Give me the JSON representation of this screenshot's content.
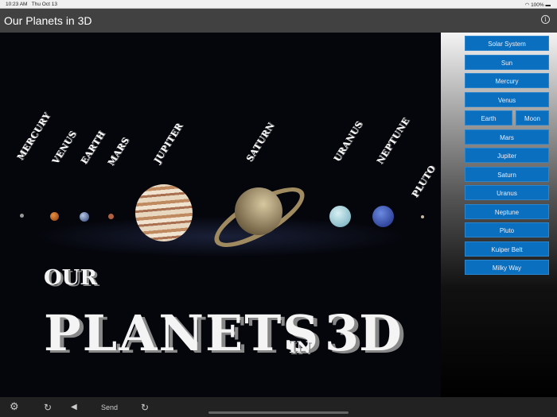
{
  "status_bar": {
    "time": "10:23 AM",
    "date": "Thu Oct 13",
    "battery": "100%"
  },
  "nav": {
    "title": "Our Planets in 3D",
    "info_icon": "info-icon"
  },
  "poster": {
    "labels": [
      "MERCURY",
      "VENUS",
      "EARTH",
      "MARS",
      "JUPITER",
      "SATURN",
      "URANUS",
      "NEPTUNE",
      "PLUTO"
    ],
    "title_our": "OUR",
    "title_planets": "PLANETS",
    "title_in": "IN",
    "title_3d": "3D"
  },
  "sidebar": {
    "buttons": [
      "Solar System",
      "Sun",
      "Mercury",
      "Venus",
      "Earth",
      "Moon",
      "Mars",
      "Jupiter",
      "Saturn",
      "Uranus",
      "Neptune",
      "Pluto",
      "Kuiper Belt",
      "Milky Way"
    ]
  },
  "toolbar": {
    "send": "Send"
  },
  "colors": {
    "button": "#0a6fbf",
    "nav": "#414141"
  }
}
